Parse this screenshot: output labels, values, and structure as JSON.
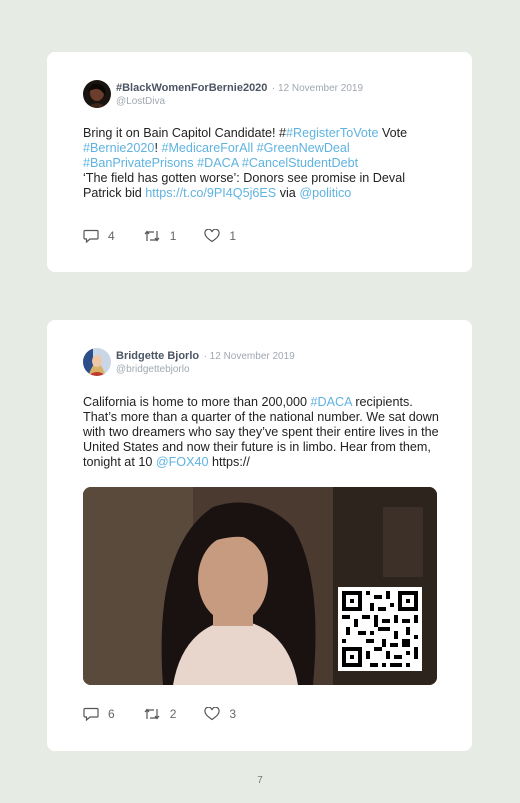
{
  "tweets": [
    {
      "name": "#BlackWomenForBernie2020",
      "date": "· 12 November 2019",
      "handle": "@LostDiva",
      "body": [
        {
          "t": "Bring it on Bain Capitol Candidate! #"
        },
        {
          "t": "#RegisterToVote",
          "h": true
        },
        {
          "t": " Vote "
        },
        {
          "t": "#Bernie2020",
          "h": true
        },
        {
          "t": "! "
        },
        {
          "t": "#MedicareForAll",
          "h": true
        },
        {
          "t": " "
        },
        {
          "t": "#GreenNewDeal",
          "h": true
        },
        {
          "t": " "
        },
        {
          "t": "#BanPrivatePrisons",
          "h": true
        },
        {
          "t": " "
        },
        {
          "t": "#DACA",
          "h": true
        },
        {
          "t": " "
        },
        {
          "t": "#CancelStudentDebt",
          "h": true
        },
        {
          "t": "\n‘The field has gotten worse’: Donors see promise in Deval Patrick bid "
        },
        {
          "t": "https://t.co/9PI4Q5j6ES",
          "h": true
        },
        {
          "t": " via "
        },
        {
          "t": "@politico",
          "h": true
        }
      ],
      "replies": "4",
      "retweets": "1",
      "likes": "1"
    },
    {
      "name": "Bridgette Bjorlo",
      "date": "· 12 November 2019",
      "handle": "@bridgettebjorlo",
      "body": [
        {
          "t": "California is home to more than 200,000 "
        },
        {
          "t": "#DACA",
          "h": true
        },
        {
          "t": " recipients. That’s more than a quarter of the national number. We sat down with two dreamers who say they’ve spent their entire lives in the United States and now their future is in limbo. Hear from them, tonight at 10 "
        },
        {
          "t": "@FOX40",
          "h": true
        },
        {
          "t": " https://"
        }
      ],
      "replies": "6",
      "retweets": "2",
      "likes": "3"
    }
  ],
  "page_number": "7",
  "colors": {
    "background": "#e6ece4",
    "card": "#ffffff",
    "link": "#5fb3e0",
    "muted": "#a0a8b0"
  },
  "icons": [
    "reply-icon",
    "retweet-icon",
    "like-icon",
    "qr-code"
  ]
}
